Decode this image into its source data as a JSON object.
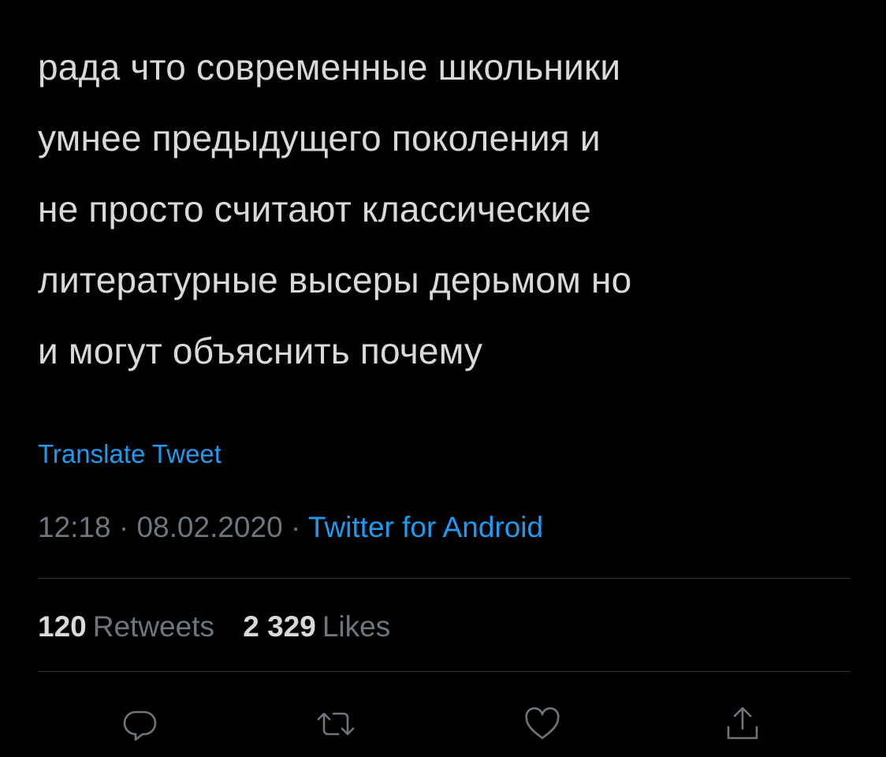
{
  "tweet": {
    "text_lines": [
      "рада что современные школьники",
      "умнее предыдущего поколения и",
      "не просто считают классические",
      "литературные высеры дерьмом но",
      "и могут объяснить почему"
    ],
    "translate_label": "Translate Tweet",
    "time": "12:18",
    "separator": "·",
    "date": "08.02.2020",
    "source": "Twitter for Android",
    "retweets_count": "120",
    "retweets_label": "Retweets",
    "likes_count": "2 329",
    "likes_label": "Likes"
  },
  "actions": {
    "reply_icon": "reply-icon",
    "retweet_icon": "retweet-icon",
    "like_icon": "heart-icon",
    "share_icon": "share-icon"
  },
  "colors": {
    "background": "#000000",
    "text": "#d9d9d9",
    "secondary": "#6e767d",
    "accent": "#1d9bf0",
    "divider": "#2f3336"
  }
}
